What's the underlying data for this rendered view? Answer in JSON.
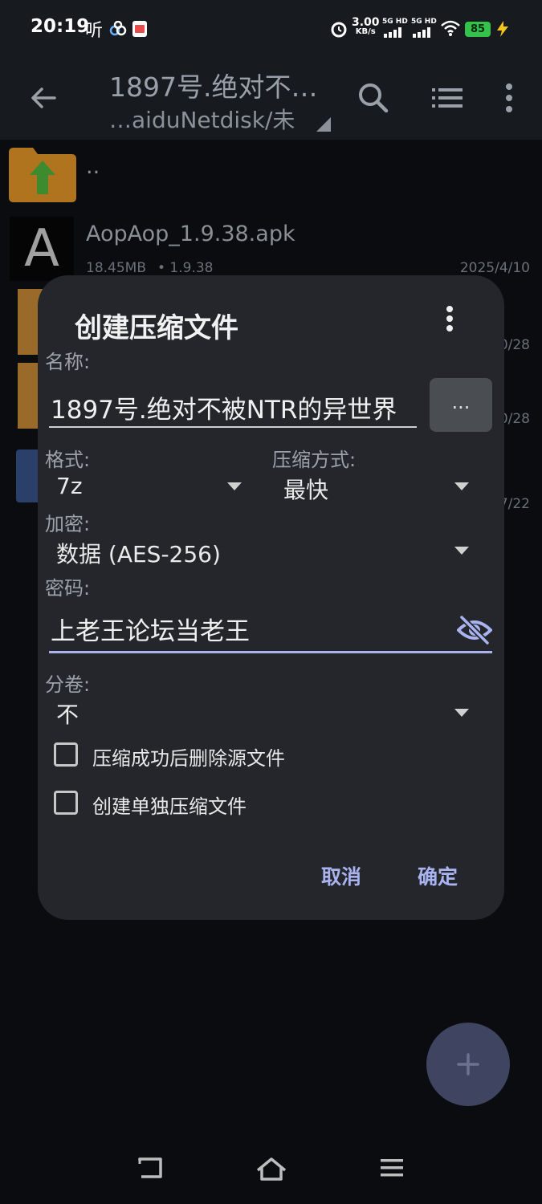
{
  "status_bar": {
    "time": "20:19",
    "listen_label": "听",
    "net_speed": "3.00",
    "net_unit": "KB/s",
    "sig1": "5G HD",
    "sig2": "5G HD",
    "battery": "85",
    "icons": [
      "baidu-netdisk-icon",
      "app-icon",
      "alarm-icon",
      "wifi-icon",
      "battery-icon",
      "charging-icon"
    ]
  },
  "app_bar": {
    "title": "1897号.绝对不…",
    "subtitle": "…aiduNetdisk/未",
    "icons": [
      "back-arrow-icon",
      "search-icon",
      "list-view-icon",
      "more-vert-icon"
    ]
  },
  "file_list": [
    {
      "name": "..",
      "type": "parent-folder"
    },
    {
      "name": "AopAop_1.9.38.apk",
      "size": "18.45MB",
      "version": "• 1.9.38",
      "date": "2025/4/10"
    },
    {
      "date": "0/28"
    },
    {
      "date": "0/28"
    },
    {
      "date": "7/22"
    }
  ],
  "dialog": {
    "title": "创建压缩文件",
    "name_label": "名称:",
    "name_value": "1897号.绝对不被NTR的异世界",
    "browse_label": "...",
    "format_label": "格式:",
    "format_value": "7z",
    "method_label": "压缩方式:",
    "method_value": "最快",
    "encrypt_label": "加密:",
    "encrypt_value": "数据 (AES-256)",
    "password_label": "密码:",
    "password_value": "上老王论坛当老王",
    "split_label": "分卷:",
    "split_value": "不",
    "checkbox_delete": {
      "label": "压缩成功后删除源文件",
      "checked": false
    },
    "checkbox_separate": {
      "label": "创建单独压缩文件",
      "checked": false
    },
    "cancel": "取消",
    "ok": "确定",
    "accent_color": "#a9b3ef"
  },
  "fab": {
    "icon": "plus-icon"
  },
  "nav_bar": {
    "icons": [
      "back-nav-icon",
      "home-nav-icon",
      "menu-nav-icon"
    ]
  }
}
